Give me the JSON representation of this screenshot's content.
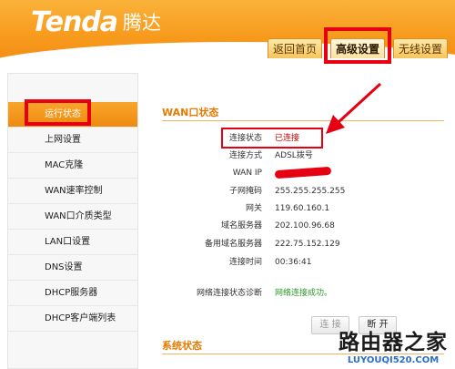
{
  "brand": {
    "logo_en": "Tenda",
    "logo_cn": "腾达"
  },
  "tabs": [
    {
      "label": "返回首页",
      "active": false
    },
    {
      "label": "高级设置",
      "active": true
    },
    {
      "label": "无线设置",
      "active": false
    }
  ],
  "sidebar": {
    "items": [
      {
        "label": "运行状态",
        "active": true
      },
      {
        "label": "上网设置"
      },
      {
        "label": "MAC克隆"
      },
      {
        "label": "WAN速率控制"
      },
      {
        "label": "WAN口介质类型"
      },
      {
        "label": "LAN口设置"
      },
      {
        "label": "DNS设置"
      },
      {
        "label": "DHCP服务器"
      },
      {
        "label": "DHCP客户端列表"
      }
    ]
  },
  "wan_status": {
    "title": "WAN口状态",
    "rows": [
      {
        "label": "连接状态",
        "value": "已连接"
      },
      {
        "label": "连接方式",
        "value": "ADSL拨号"
      },
      {
        "label": "WAN IP",
        "value": ""
      },
      {
        "label": "子网掩码",
        "value": "255.255.255.255"
      },
      {
        "label": "网关",
        "value": "119.60.160.1"
      },
      {
        "label": "域名服务器",
        "value": "202.100.96.68"
      },
      {
        "label": "备用域名服务器",
        "value": "222.75.152.129"
      },
      {
        "label": "连接时间",
        "value": "00:36:41"
      }
    ],
    "diag_label": "网络连接状态诊断",
    "diag_value": "网络连接成功。",
    "connect_btn": "连 接",
    "disconnect_btn": "断 开"
  },
  "system_status": {
    "title": "系统状态"
  },
  "watermark": {
    "cn": "路由器之家",
    "url": "LUYOUQI520.COM"
  },
  "colors": {
    "accent": "#f79a1c",
    "highlight": "#e60012",
    "ok": "#2a9a2a",
    "connected": "#cc0000"
  }
}
